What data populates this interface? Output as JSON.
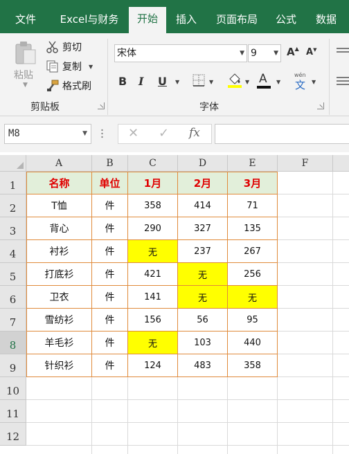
{
  "ribbon_tabs": [
    {
      "label": "文件",
      "active": false
    },
    {
      "label": "Excel与财务",
      "active": false
    },
    {
      "label": "开始",
      "active": true
    },
    {
      "label": "插入",
      "active": false
    },
    {
      "label": "页面布局",
      "active": false
    },
    {
      "label": "公式",
      "active": false
    },
    {
      "label": "数据",
      "active": false
    }
  ],
  "clipboard": {
    "paste_label": "粘贴",
    "cut_label": "剪切",
    "copy_label": "复制",
    "format_painter_label": "格式刷",
    "group_label": "剪贴板"
  },
  "font": {
    "font_name": "宋体",
    "font_size": "9",
    "bold": "B",
    "italic": "I",
    "underline": "U",
    "font_color_glyph": "A",
    "phonetic_top": "wén",
    "phonetic_bottom": "文",
    "group_label": "字体"
  },
  "formula_bar": {
    "name_box": "M8",
    "fx": "fx",
    "formula": ""
  },
  "grid": {
    "column_headers": [
      "A",
      "B",
      "C",
      "D",
      "E",
      "F"
    ],
    "row_headers": [
      "1",
      "2",
      "3",
      "4",
      "5",
      "6",
      "7",
      "8",
      "9",
      "10",
      "11",
      "12"
    ],
    "selected_row": "8",
    "table": {
      "headers": [
        "名称",
        "单位",
        "1月",
        "2月",
        "3月"
      ],
      "rows": [
        [
          "T恤",
          "件",
          "358",
          "414",
          "71"
        ],
        [
          "背心",
          "件",
          "290",
          "327",
          "135"
        ],
        [
          "衬衫",
          "件",
          "无",
          "237",
          "267"
        ],
        [
          "打底衫",
          "件",
          "421",
          "无",
          "256"
        ],
        [
          "卫衣",
          "件",
          "141",
          "无",
          "无"
        ],
        [
          "雪纺衫",
          "件",
          "156",
          "56",
          "95"
        ],
        [
          "羊毛衫",
          "件",
          "无",
          "103",
          "440"
        ],
        [
          "针织衫",
          "件",
          "124",
          "483",
          "358"
        ]
      ]
    }
  },
  "colors": {
    "accent": "#217346",
    "header_fill": "#e2efda",
    "header_text": "#e00000",
    "highlight": "#ffff00",
    "table_border": "#e08a3a"
  }
}
